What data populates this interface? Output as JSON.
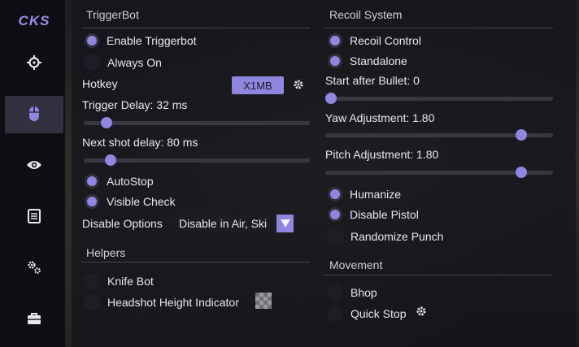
{
  "sidebar": {
    "logo": "CKS",
    "items": [
      {
        "icon": "crosshair-icon",
        "active": false
      },
      {
        "icon": "mouse-icon",
        "active": true
      },
      {
        "icon": "eye-icon",
        "active": false
      },
      {
        "icon": "document-icon",
        "active": false
      },
      {
        "icon": "gears-icon",
        "active": false
      },
      {
        "icon": "briefcase-icon",
        "active": false
      }
    ]
  },
  "triggerbot": {
    "title": "TriggerBot",
    "enable_label": "Enable Triggerbot",
    "enable_on": true,
    "always_on_label": "Always On",
    "always_on": false,
    "hotkey_label": "Hotkey",
    "hotkey_value": "X1MB",
    "trigger_delay_label": "Trigger Delay:  32 ms",
    "trigger_delay_fraction": 0.08,
    "next_shot_label": "Next shot delay:  80 ms",
    "next_shot_fraction": 0.1,
    "autostop_label": "AutoStop",
    "autostop_on": true,
    "visible_check_label": "Visible Check",
    "visible_check_on": true,
    "disable_options_label": "Disable Options",
    "disable_options_value": "Disable in Air, Ski"
  },
  "helpers": {
    "title": "Helpers",
    "knife_bot_label": "Knife Bot",
    "knife_bot_on": false,
    "headshot_label": "Headshot Height Indicator",
    "headshot_on": false
  },
  "recoil": {
    "title": "Recoil System",
    "recoil_control_label": "Recoil Control",
    "recoil_control_on": true,
    "standalone_label": "Standalone",
    "standalone_on": true,
    "start_after_label": "Start after Bullet:  0",
    "start_after_fraction": 0.0,
    "yaw_label": "Yaw Adjustment:   1.80",
    "yaw_fraction": 0.88,
    "pitch_label": "Pitch Adjustment:   1.80",
    "pitch_fraction": 0.88,
    "humanize_label": "Humanize",
    "humanize_on": true,
    "disable_pistol_label": "Disable Pistol",
    "disable_pistol_on": true,
    "randomize_punch_label": "Randomize Punch",
    "randomize_punch_on": false
  },
  "movement": {
    "title": "Movement",
    "bhop_label": "Bhop",
    "bhop_on": false,
    "quick_stop_label": "Quick Stop",
    "quick_stop_on": false
  },
  "colors": {
    "accent": "#8f86df",
    "panel": "#14141a",
    "sidebar": "#0e0e14"
  }
}
